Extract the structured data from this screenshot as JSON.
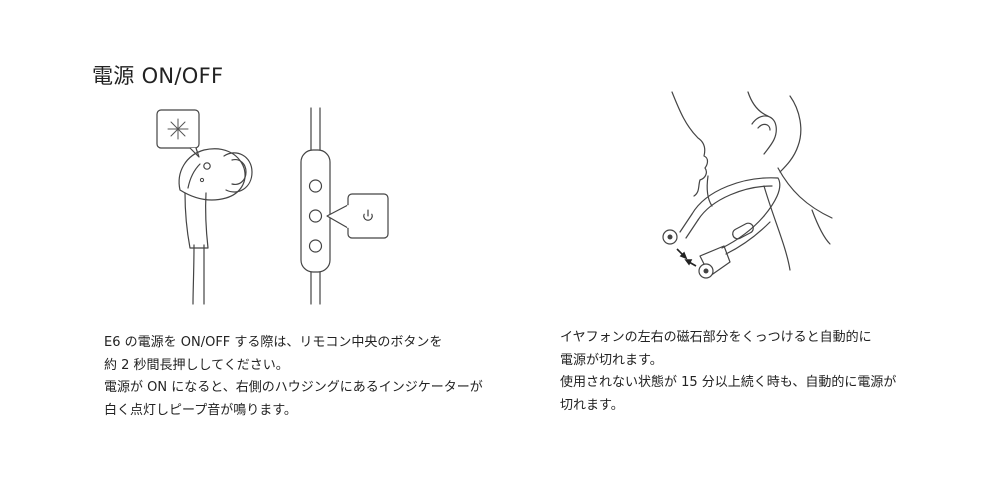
{
  "section": {
    "title": "電源 ON/OFF"
  },
  "left_text": {
    "lines": [
      "E6 の電源を ON/OFF する際は、リモコン中央のボタンを",
      "約 2 秒間長押ししてください。",
      "電源が ON になると、右側のハウジングにあるインジケーターが",
      "白く点灯しピープ音が鳴ります。"
    ]
  },
  "right_text": {
    "lines": [
      "イヤフォンの左右の磁石部分をくっつけると自動的に",
      "電源が切れます。",
      "使用されない状態が 15 分以上続く時も、自動的に電源が",
      "切れます。"
    ]
  },
  "icons": [
    "indicator-light-icon",
    "power-icon"
  ]
}
